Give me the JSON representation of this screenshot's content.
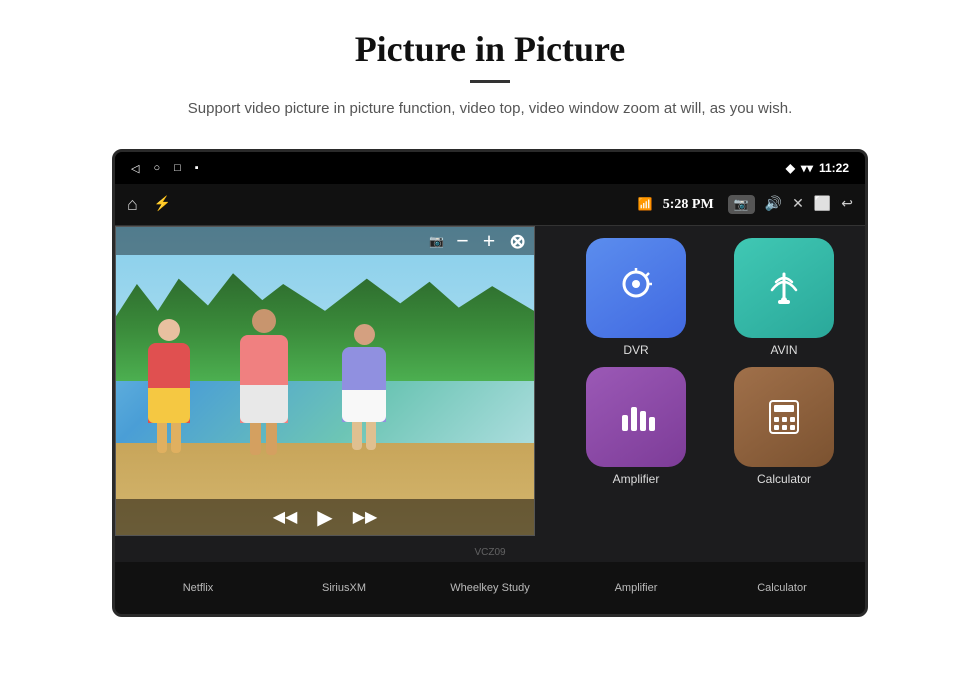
{
  "header": {
    "title": "Picture in Picture",
    "subtitle": "Support video picture in picture function, video top, video window zoom at will, as you wish."
  },
  "statusBar": {
    "time": "11:22",
    "leftIcons": [
      "◁",
      "○",
      "□",
      "▪"
    ]
  },
  "navBar": {
    "time": "5:28 PM",
    "icons": [
      "⌂",
      "⚡",
      "📶",
      "🔊",
      "✕",
      "⬜",
      "↩"
    ]
  },
  "appGrid": [
    {
      "label": "DVR",
      "color": "blue",
      "icon": "📡"
    },
    {
      "label": "AVIN",
      "color": "teal",
      "icon": "🔌"
    },
    {
      "label": "Amplifier",
      "color": "purple-dark",
      "icon": "📊"
    },
    {
      "label": "Calculator",
      "color": "brown",
      "icon": "🧮"
    }
  ],
  "bottomApps": [
    {
      "label": "Netflix",
      "color": "#e50914"
    },
    {
      "label": "SiriusXM",
      "color": "#00aff0"
    },
    {
      "label": "Wheelkey Study",
      "color": "#ff6600"
    }
  ],
  "pipControls": {
    "minus": "−",
    "plus": "+",
    "close": "⊗"
  },
  "videoControls": {
    "rewind": "◀◀",
    "play": "▶",
    "forward": "▶▶"
  },
  "watermark": "VCZ09"
}
